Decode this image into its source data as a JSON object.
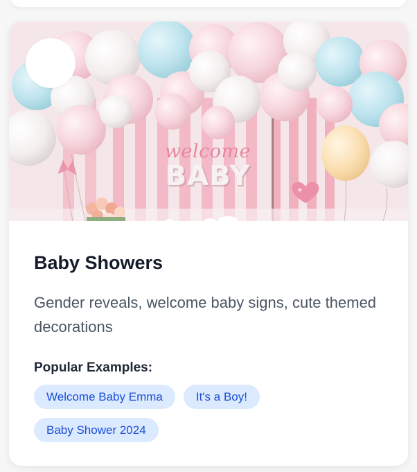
{
  "card": {
    "title": "Baby Showers",
    "description": "Gender reveals, welcome baby signs, cute themed decorations",
    "examples_label": "Popular Examples:",
    "examples": [
      "Welcome Baby Emma",
      "It's a Boy!",
      "Baby Shower 2024"
    ],
    "image": {
      "sign_top": "welcome",
      "sign_bottom": "BABY"
    }
  },
  "colors": {
    "chip_bg": "#dbeafe",
    "chip_text": "#1d4ed8",
    "title": "#141b2b",
    "description": "#4b5563"
  }
}
